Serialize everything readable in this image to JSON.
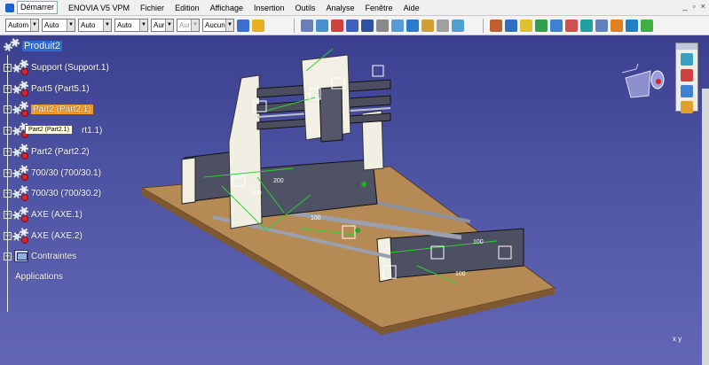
{
  "menu": {
    "start": "Démarrer",
    "items": [
      "ENOVIA V5 VPM",
      "Fichier",
      "Edition",
      "Affichage",
      "Insertion",
      "Outils",
      "Analyse",
      "Fenêtre",
      "Aide"
    ]
  },
  "toolbar": {
    "combos": [
      {
        "value": "Autom",
        "disabled": false
      },
      {
        "value": "Auto",
        "disabled": false
      },
      {
        "value": "Auto",
        "disabled": false
      },
      {
        "value": "Auto",
        "disabled": false
      },
      {
        "value": "Aur",
        "disabled": false
      },
      {
        "value": "Aur",
        "disabled": true
      },
      {
        "value": "Aucun",
        "disabled": false
      }
    ]
  },
  "tree": {
    "root": "Produit2",
    "items": [
      {
        "label": "Support (Support.1)",
        "selected": false
      },
      {
        "label": "Part5 (Part5.1)",
        "selected": false
      },
      {
        "label": "Part2 (Part2.1)",
        "selected": true
      },
      {
        "label": "rt1.1)",
        "selected": false
      },
      {
        "label": "Part2 (Part2.2)",
        "selected": false
      },
      {
        "label": "700/30 (700/30.1)",
        "selected": false
      },
      {
        "label": "700/30 (700/30.2)",
        "selected": false
      },
      {
        "label": "AXE (AXE.1)",
        "selected": false
      },
      {
        "label": "AXE (AXE.2)",
        "selected": false
      }
    ],
    "constraints": "Contraintes",
    "applications": "Applications",
    "tooltip": "Part2 (Part2.1)"
  },
  "scene": {
    "dims": [
      "100",
      "100",
      "200",
      "100",
      "100",
      "100"
    ]
  },
  "axes_label": "x y"
}
